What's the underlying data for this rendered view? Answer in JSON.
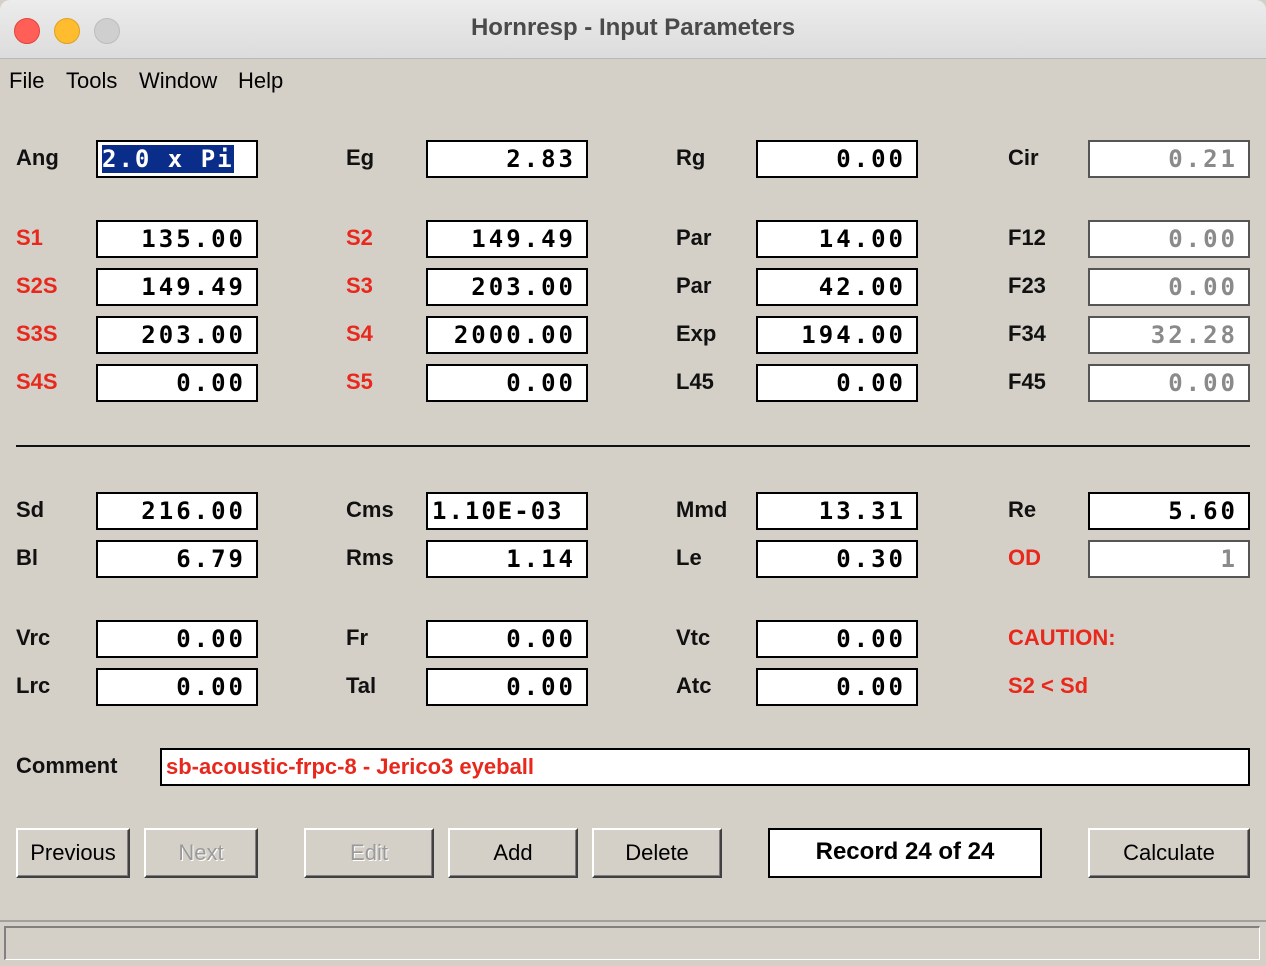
{
  "window": {
    "title": "Hornresp - Input Parameters"
  },
  "menu": [
    "File",
    "Tools",
    "Window",
    "Help"
  ],
  "rows": {
    "r1": [
      {
        "label": "Ang",
        "value": "2.0 x Pi"
      },
      {
        "label": "Eg",
        "value": "2.83"
      },
      {
        "label": "Rg",
        "value": "0.00"
      },
      {
        "label": "Cir",
        "value": "0.21"
      }
    ],
    "r2": [
      {
        "label": "S1",
        "value": "135.00"
      },
      {
        "label": "S2",
        "value": "149.49"
      },
      {
        "label": "Par",
        "value": "14.00"
      },
      {
        "label": "F12",
        "value": "0.00"
      }
    ],
    "r3": [
      {
        "label": "S2S",
        "value": "149.49"
      },
      {
        "label": "S3",
        "value": "203.00"
      },
      {
        "label": "Par",
        "value": "42.00"
      },
      {
        "label": "F23",
        "value": "0.00"
      }
    ],
    "r4": [
      {
        "label": "S3S",
        "value": "203.00"
      },
      {
        "label": "S4",
        "value": "2000.00"
      },
      {
        "label": "Exp",
        "value": "194.00"
      },
      {
        "label": "F34",
        "value": "32.28"
      }
    ],
    "r5": [
      {
        "label": "S4S",
        "value": "0.00"
      },
      {
        "label": "S5",
        "value": "0.00"
      },
      {
        "label": "L45",
        "value": "0.00"
      },
      {
        "label": "F45",
        "value": "0.00"
      }
    ],
    "r6": [
      {
        "label": "Sd",
        "value": "216.00"
      },
      {
        "label": "Cms",
        "value": "1.10E-03"
      },
      {
        "label": "Mmd",
        "value": "13.31"
      },
      {
        "label": "Re",
        "value": "5.60"
      }
    ],
    "r7": [
      {
        "label": "Bl",
        "value": "6.79"
      },
      {
        "label": "Rms",
        "value": "1.14"
      },
      {
        "label": "Le",
        "value": "0.30"
      },
      {
        "label": "OD",
        "value": "1"
      }
    ],
    "r8": [
      {
        "label": "Vrc",
        "value": "0.00"
      },
      {
        "label": "Fr",
        "value": "0.00"
      },
      {
        "label": "Vtc",
        "value": "0.00"
      }
    ],
    "r9": [
      {
        "label": "Lrc",
        "value": "0.00"
      },
      {
        "label": "Tal",
        "value": "0.00"
      },
      {
        "label": "Atc",
        "value": "0.00"
      }
    ]
  },
  "caution": {
    "title": "CAUTION:",
    "message": "S2 < Sd"
  },
  "comment": {
    "label": "Comment",
    "value": "sb-acoustic-frpc-8 - Jerico3 eyeball"
  },
  "buttons": {
    "previous": "Previous",
    "next": "Next",
    "edit": "Edit",
    "add": "Add",
    "delete": "Delete",
    "calculate": "Calculate"
  },
  "record": "Record 24 of 24",
  "colors": {
    "warning_red": "#e8281c",
    "face": "#d4d0c8",
    "selection": "#0b2d8a"
  }
}
